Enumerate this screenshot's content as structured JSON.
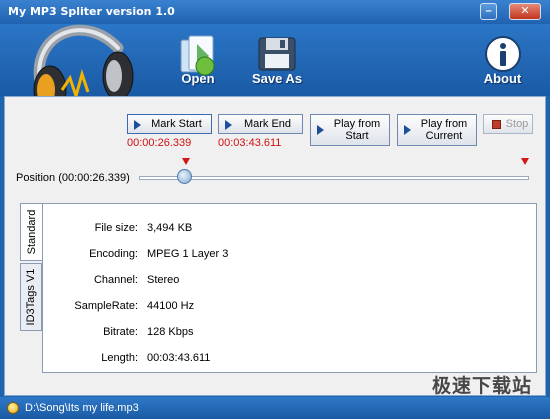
{
  "window": {
    "title": "My MP3 Spliter  version 1.0"
  },
  "toolbar": {
    "open_label": "Open",
    "save_as_label": "Save As",
    "about_label": "About"
  },
  "controls": {
    "mark_start": "Mark Start",
    "mark_end": "Mark End",
    "play_from_start_1": "Play from",
    "play_from_start_2": "Start",
    "play_from_current_1": "Play from",
    "play_from_current_2": "Current",
    "stop": "Stop",
    "mark_start_time": "00:00:26.339",
    "mark_end_time": "00:03:43.611"
  },
  "position": {
    "label": "Position (00:00:26.339)",
    "fraction": 0.117
  },
  "tabs": [
    {
      "label": "Standard",
      "active": true
    },
    {
      "label": "ID3Tags V1",
      "active": false
    }
  ],
  "info": {
    "file_size_label": "File size:",
    "file_size": "3,494 KB",
    "encoding_label": "Encoding:",
    "encoding": "MPEG 1 Layer 3",
    "channel_label": "Channel:",
    "channel": "Stereo",
    "samplerate_label": "SampleRate:",
    "samplerate": "44100 Hz",
    "bitrate_label": "Bitrate:",
    "bitrate": "128 Kbps",
    "length_label": "Length:",
    "length": "00:03:43.611"
  },
  "status": {
    "path": "D:\\Song\\Its my life.mp3"
  },
  "watermark": "极速下载站",
  "colors": {
    "accent": "#1d63ad",
    "time_red": "#d01010"
  }
}
